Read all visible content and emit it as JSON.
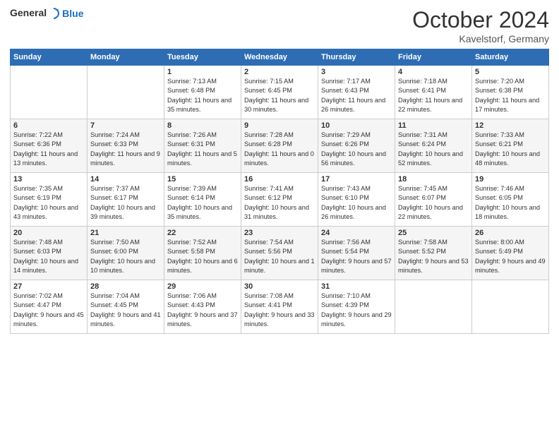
{
  "logo": {
    "line1": "General",
    "line2": "Blue"
  },
  "title": "October 2024",
  "location": "Kavelstorf, Germany",
  "days_of_week": [
    "Sunday",
    "Monday",
    "Tuesday",
    "Wednesday",
    "Thursday",
    "Friday",
    "Saturday"
  ],
  "weeks": [
    [
      {
        "day": "",
        "sunrise": "",
        "sunset": "",
        "daylight": ""
      },
      {
        "day": "",
        "sunrise": "",
        "sunset": "",
        "daylight": ""
      },
      {
        "day": "1",
        "sunrise": "Sunrise: 7:13 AM",
        "sunset": "Sunset: 6:48 PM",
        "daylight": "Daylight: 11 hours and 35 minutes."
      },
      {
        "day": "2",
        "sunrise": "Sunrise: 7:15 AM",
        "sunset": "Sunset: 6:45 PM",
        "daylight": "Daylight: 11 hours and 30 minutes."
      },
      {
        "day": "3",
        "sunrise": "Sunrise: 7:17 AM",
        "sunset": "Sunset: 6:43 PM",
        "daylight": "Daylight: 11 hours and 26 minutes."
      },
      {
        "day": "4",
        "sunrise": "Sunrise: 7:18 AM",
        "sunset": "Sunset: 6:41 PM",
        "daylight": "Daylight: 11 hours and 22 minutes."
      },
      {
        "day": "5",
        "sunrise": "Sunrise: 7:20 AM",
        "sunset": "Sunset: 6:38 PM",
        "daylight": "Daylight: 11 hours and 17 minutes."
      }
    ],
    [
      {
        "day": "6",
        "sunrise": "Sunrise: 7:22 AM",
        "sunset": "Sunset: 6:36 PM",
        "daylight": "Daylight: 11 hours and 13 minutes."
      },
      {
        "day": "7",
        "sunrise": "Sunrise: 7:24 AM",
        "sunset": "Sunset: 6:33 PM",
        "daylight": "Daylight: 11 hours and 9 minutes."
      },
      {
        "day": "8",
        "sunrise": "Sunrise: 7:26 AM",
        "sunset": "Sunset: 6:31 PM",
        "daylight": "Daylight: 11 hours and 5 minutes."
      },
      {
        "day": "9",
        "sunrise": "Sunrise: 7:28 AM",
        "sunset": "Sunset: 6:28 PM",
        "daylight": "Daylight: 11 hours and 0 minutes."
      },
      {
        "day": "10",
        "sunrise": "Sunrise: 7:29 AM",
        "sunset": "Sunset: 6:26 PM",
        "daylight": "Daylight: 10 hours and 56 minutes."
      },
      {
        "day": "11",
        "sunrise": "Sunrise: 7:31 AM",
        "sunset": "Sunset: 6:24 PM",
        "daylight": "Daylight: 10 hours and 52 minutes."
      },
      {
        "day": "12",
        "sunrise": "Sunrise: 7:33 AM",
        "sunset": "Sunset: 6:21 PM",
        "daylight": "Daylight: 10 hours and 48 minutes."
      }
    ],
    [
      {
        "day": "13",
        "sunrise": "Sunrise: 7:35 AM",
        "sunset": "Sunset: 6:19 PM",
        "daylight": "Daylight: 10 hours and 43 minutes."
      },
      {
        "day": "14",
        "sunrise": "Sunrise: 7:37 AM",
        "sunset": "Sunset: 6:17 PM",
        "daylight": "Daylight: 10 hours and 39 minutes."
      },
      {
        "day": "15",
        "sunrise": "Sunrise: 7:39 AM",
        "sunset": "Sunset: 6:14 PM",
        "daylight": "Daylight: 10 hours and 35 minutes."
      },
      {
        "day": "16",
        "sunrise": "Sunrise: 7:41 AM",
        "sunset": "Sunset: 6:12 PM",
        "daylight": "Daylight: 10 hours and 31 minutes."
      },
      {
        "day": "17",
        "sunrise": "Sunrise: 7:43 AM",
        "sunset": "Sunset: 6:10 PM",
        "daylight": "Daylight: 10 hours and 26 minutes."
      },
      {
        "day": "18",
        "sunrise": "Sunrise: 7:45 AM",
        "sunset": "Sunset: 6:07 PM",
        "daylight": "Daylight: 10 hours and 22 minutes."
      },
      {
        "day": "19",
        "sunrise": "Sunrise: 7:46 AM",
        "sunset": "Sunset: 6:05 PM",
        "daylight": "Daylight: 10 hours and 18 minutes."
      }
    ],
    [
      {
        "day": "20",
        "sunrise": "Sunrise: 7:48 AM",
        "sunset": "Sunset: 6:03 PM",
        "daylight": "Daylight: 10 hours and 14 minutes."
      },
      {
        "day": "21",
        "sunrise": "Sunrise: 7:50 AM",
        "sunset": "Sunset: 6:00 PM",
        "daylight": "Daylight: 10 hours and 10 minutes."
      },
      {
        "day": "22",
        "sunrise": "Sunrise: 7:52 AM",
        "sunset": "Sunset: 5:58 PM",
        "daylight": "Daylight: 10 hours and 6 minutes."
      },
      {
        "day": "23",
        "sunrise": "Sunrise: 7:54 AM",
        "sunset": "Sunset: 5:56 PM",
        "daylight": "Daylight: 10 hours and 1 minute."
      },
      {
        "day": "24",
        "sunrise": "Sunrise: 7:56 AM",
        "sunset": "Sunset: 5:54 PM",
        "daylight": "Daylight: 9 hours and 57 minutes."
      },
      {
        "day": "25",
        "sunrise": "Sunrise: 7:58 AM",
        "sunset": "Sunset: 5:52 PM",
        "daylight": "Daylight: 9 hours and 53 minutes."
      },
      {
        "day": "26",
        "sunrise": "Sunrise: 8:00 AM",
        "sunset": "Sunset: 5:49 PM",
        "daylight": "Daylight: 9 hours and 49 minutes."
      }
    ],
    [
      {
        "day": "27",
        "sunrise": "Sunrise: 7:02 AM",
        "sunset": "Sunset: 4:47 PM",
        "daylight": "Daylight: 9 hours and 45 minutes."
      },
      {
        "day": "28",
        "sunrise": "Sunrise: 7:04 AM",
        "sunset": "Sunset: 4:45 PM",
        "daylight": "Daylight: 9 hours and 41 minutes."
      },
      {
        "day": "29",
        "sunrise": "Sunrise: 7:06 AM",
        "sunset": "Sunset: 4:43 PM",
        "daylight": "Daylight: 9 hours and 37 minutes."
      },
      {
        "day": "30",
        "sunrise": "Sunrise: 7:08 AM",
        "sunset": "Sunset: 4:41 PM",
        "daylight": "Daylight: 9 hours and 33 minutes."
      },
      {
        "day": "31",
        "sunrise": "Sunrise: 7:10 AM",
        "sunset": "Sunset: 4:39 PM",
        "daylight": "Daylight: 9 hours and 29 minutes."
      },
      {
        "day": "",
        "sunrise": "",
        "sunset": "",
        "daylight": ""
      },
      {
        "day": "",
        "sunrise": "",
        "sunset": "",
        "daylight": ""
      }
    ]
  ]
}
